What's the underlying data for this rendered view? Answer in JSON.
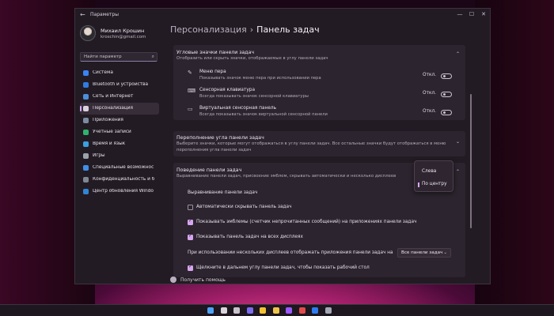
{
  "window": {
    "title": "Параметры",
    "back_glyph": "←",
    "controls": [
      "—",
      "☐",
      "✕"
    ]
  },
  "profile": {
    "name": "Михаил Крошин",
    "email": "kroschin@gmail.com"
  },
  "search": {
    "placeholder": "Найти параметр"
  },
  "nav": [
    {
      "label": "Система",
      "icon": "system-icon",
      "color": "#3b82f6"
    },
    {
      "label": "Bluetooth и устройства",
      "icon": "bluetooth-icon",
      "color": "#2f7de1"
    },
    {
      "label": "Сеть и Интернет",
      "icon": "network-icon",
      "color": "#4a90d9"
    },
    {
      "label": "Персонализация",
      "icon": "brush-icon",
      "color": "#d8d0dc",
      "active": true
    },
    {
      "label": "Приложения",
      "icon": "apps-icon",
      "color": "#7c8ba1"
    },
    {
      "label": "Учетные записи",
      "icon": "account-icon",
      "color": "#2fb36b"
    },
    {
      "label": "Время и язык",
      "icon": "globe-time-icon",
      "color": "#3aa0e0"
    },
    {
      "label": "Игры",
      "icon": "gamepad-icon",
      "color": "#9aa3ad"
    },
    {
      "label": "Специальные возможнос",
      "icon": "accessibility-icon",
      "color": "#3f8fe8"
    },
    {
      "label": "Конфиденциальность и б",
      "icon": "shield-icon",
      "color": "#7f8792"
    },
    {
      "label": "Центр обновления Windo",
      "icon": "update-icon",
      "color": "#2f86d6"
    }
  ],
  "breadcrumb": {
    "parent": "Персонализация",
    "separator": "›",
    "current": "Панель задач"
  },
  "corner_icons": {
    "title": "Угловые значки панели задач",
    "subtitle": "Отобразить или скрыть значки, отображаемые в углу панели задач",
    "rows": [
      {
        "title": "Меню пера",
        "subtitle": "Показывать значок меню пера при использовании пера",
        "state": "Откл.",
        "icon": "pen-icon"
      },
      {
        "title": "Сенсорная клавиатура",
        "subtitle": "Всегда показывать значок сенсорной клавиатуры",
        "state": "Откл.",
        "icon": "keyboard-icon"
      },
      {
        "title": "Виртуальная сенсорная панель",
        "subtitle": "Всегда показывать значок виртуальной сенсорной панели",
        "state": "Откл.",
        "icon": "touchpad-icon"
      }
    ]
  },
  "overflow": {
    "title": "Переполнение угла панели задач",
    "subtitle_1": "Выберите значки, которые могут отображаться в углу панели задач. Все остальные значки будут отображаться в меню",
    "subtitle_2": "переполнения угла панели задач"
  },
  "behavior": {
    "title": "Поведение панели задач",
    "subtitle": "Выравнивание панели задач, присвоение эмблем, скрывать автоматически и несколько дисплеев",
    "alignment_label": "Выравнивание панели задач",
    "checkboxes": [
      {
        "label": "Автоматически скрывать панель задач",
        "checked": false
      },
      {
        "label": "Показывать эмблемы (счетчик непрочитанных сообщений) на приложениях панели задач",
        "checked": true
      },
      {
        "label": "Показывать панель задач на всех дисплеях",
        "checked": true
      }
    ],
    "multi_display_label": "При использовании нескольких дисплеев отображать приложения панели задач на",
    "multi_display_value": "Все панели задач",
    "corner_click_label": "Щелкните в дальнем углу панели задач, чтобы показать рабочий стол",
    "corner_click_checked": true
  },
  "dropdown": {
    "options": [
      "Слева",
      "По центру"
    ],
    "selected": "По центру"
  },
  "help": {
    "label": "Получить помощь"
  },
  "taskbar_icons": [
    {
      "icon": "windows-start-icon",
      "color": "#4fa3f7"
    },
    {
      "icon": "search-taskbar-icon",
      "color": "#d9d4dc"
    },
    {
      "icon": "task-view-icon",
      "color": "#c8c2cc"
    },
    {
      "icon": "chat-icon",
      "color": "#7b6cf0"
    },
    {
      "icon": "chrome-icon",
      "color": "#f2c230"
    },
    {
      "icon": "folder-icon",
      "color": "#f0c44a"
    },
    {
      "icon": "premiere-icon",
      "color": "#9b59ff"
    },
    {
      "icon": "record-icon",
      "color": "#e24b4b"
    },
    {
      "icon": "photoshop-icon",
      "color": "#2d7df0"
    },
    {
      "icon": "settings-gear-icon",
      "color": "#a3a9b4"
    }
  ]
}
